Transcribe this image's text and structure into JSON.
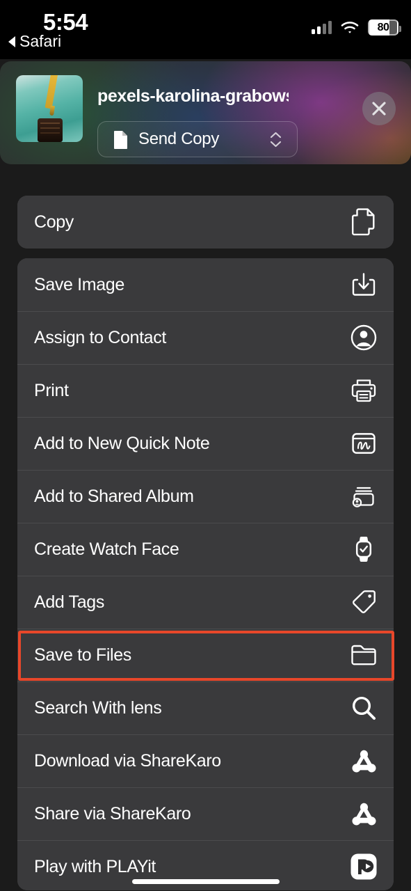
{
  "status_bar": {
    "time": "5:54",
    "back_label": "Safari",
    "back_icon": "triangle-left-icon",
    "signal_icon": "cellular-signal-icon",
    "wifi_icon": "wifi-icon",
    "battery_level": "80"
  },
  "header": {
    "file_name": "pexels-karolina-grabowska-...",
    "thumbnail_icon": "image-thumbnail",
    "send_option": {
      "label": "Send Copy",
      "icon": "document-icon",
      "chevron_icon": "chevron-up-down-icon"
    },
    "close_icon": "close-icon"
  },
  "primary_card": {
    "rows": [
      {
        "label": "Copy",
        "icon": "copy-documents-icon"
      }
    ]
  },
  "actions_card": {
    "rows": [
      {
        "label": "Save Image",
        "icon": "download-box-icon"
      },
      {
        "label": "Assign to Contact",
        "icon": "person-circle-icon"
      },
      {
        "label": "Print",
        "icon": "printer-icon"
      },
      {
        "label": "Add to New Quick Note",
        "icon": "quick-note-icon"
      },
      {
        "label": "Add to Shared Album",
        "icon": "shared-album-icon"
      },
      {
        "label": "Create Watch Face",
        "icon": "apple-watch-icon"
      },
      {
        "label": "Add Tags",
        "icon": "tag-icon"
      },
      {
        "label": "Save to Files",
        "icon": "folder-icon"
      },
      {
        "label": "Search With lens",
        "icon": "magnifier-icon"
      },
      {
        "label": "Download via ShareKaro",
        "icon": "sharekaro-icon"
      },
      {
        "label": "Share via ShareKaro",
        "icon": "sharekaro-icon"
      },
      {
        "label": "Play with PLAYit",
        "icon": "playit-icon"
      }
    ]
  },
  "annotation": {
    "highlighted_row_label": "Save to Files",
    "highlight_color": "#e8472a"
  },
  "colors": {
    "screen_background": "#1b1b1b",
    "card_background": "#3a3a3c",
    "status_bar_background": "#000000",
    "text_primary": "#ffffff"
  }
}
